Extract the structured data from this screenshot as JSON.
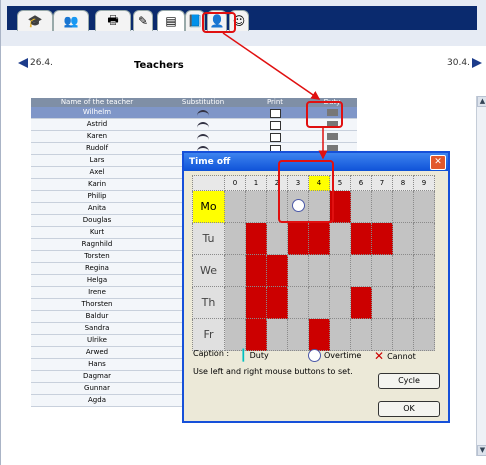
{
  "nav": {
    "prev_date": "26.4.",
    "next_date": "30.4.",
    "title": "Teachers"
  },
  "table": {
    "headers": {
      "name": "Name of the teacher",
      "substitution": "Substitution",
      "print": "Print",
      "duty": "Duty"
    },
    "rows": [
      "Wilhelm",
      "Astrid",
      "Karen",
      "Rudolf",
      "Lars",
      "Axel",
      "Karin",
      "Philip",
      "Anita",
      "Douglas",
      "Kurt",
      "Ragnhild",
      "Torsten",
      "Regina",
      "Helga",
      "Irene",
      "Thorsten",
      "Baldur",
      "Sandra",
      "Ulrike",
      "Arwed",
      "Hans",
      "Dagmar",
      "Gunnar",
      "Agda"
    ]
  },
  "dialog": {
    "title": "Time off",
    "periods": [
      "0",
      "1",
      "2",
      "3",
      "4",
      "5",
      "6",
      "7",
      "8",
      "9"
    ],
    "days": [
      "Mo",
      "Tu",
      "We",
      "Th",
      "Fr"
    ],
    "caption": "Caption :",
    "legend_duty": "Duty",
    "legend_overtime": "Overtime",
    "legend_cannot": "Cannot",
    "hint": "Use left and right mouse buttons to set.",
    "cycle_button": "Cycle",
    "ok_button": "OK",
    "cannot_color": "#cc0000",
    "highlight_color": "#ffff00"
  }
}
